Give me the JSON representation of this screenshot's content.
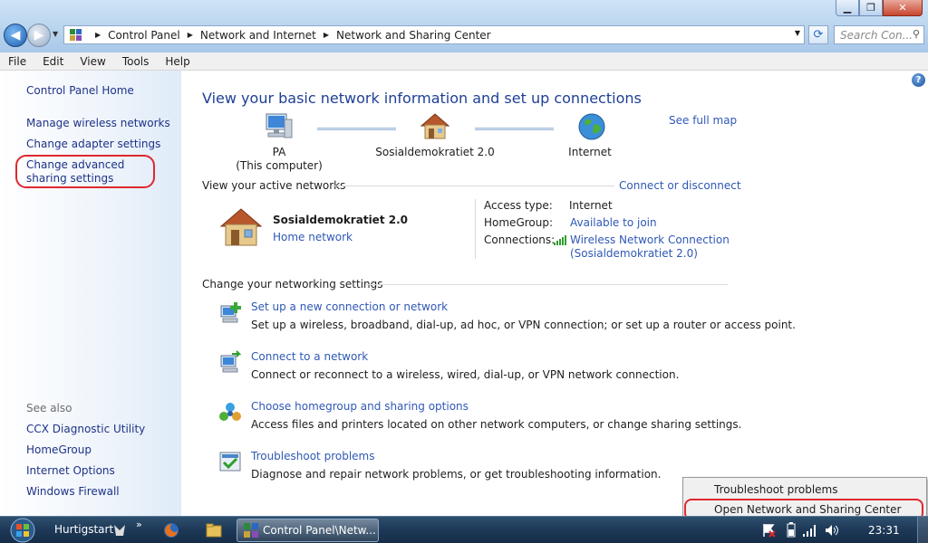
{
  "window": {
    "controls": {
      "minimize": "▁",
      "maximize": "❐",
      "close": "✕"
    }
  },
  "address_bar": {
    "breadcrumbs": [
      "Control Panel",
      "Network and Internet",
      "Network and Sharing Center"
    ],
    "search_placeholder": "Search Con..."
  },
  "menu": [
    "File",
    "Edit",
    "View",
    "Tools",
    "Help"
  ],
  "left_panel": {
    "home": "Control Panel Home",
    "links": [
      "Manage wireless networks",
      "Change adapter settings",
      "Change advanced sharing settings"
    ],
    "see_also_label": "See also",
    "see_also": [
      "CCX Diagnostic Utility",
      "HomeGroup",
      "Internet Options",
      "Windows Firewall"
    ]
  },
  "main": {
    "title": "View your basic network information and set up connections",
    "see_full_map": "See full map",
    "map": {
      "computer_name": "PA",
      "computer_sub": "(This computer)",
      "network": "Sosialdemokratiet 2.0",
      "internet": "Internet"
    },
    "active_networks": {
      "heading": "View your active networks",
      "connect_link": "Connect or disconnect",
      "network_name": "Sosialdemokratiet 2.0",
      "network_type": "Home network",
      "access_type_label": "Access type:",
      "access_type_value": "Internet",
      "homegroup_label": "HomeGroup:",
      "homegroup_value": "Available to join",
      "connections_label": "Connections:",
      "connection_line1": "Wireless Network Connection",
      "connection_line2": "(Sosialdemokratiet 2.0)"
    },
    "settings": {
      "heading": "Change your networking settings",
      "tasks": [
        {
          "link": "Set up a new connection or network",
          "desc": "Set up a wireless, broadband, dial-up, ad hoc, or VPN connection; or set up a router or access point."
        },
        {
          "link": "Connect to a network",
          "desc": "Connect or reconnect to a wireless, wired, dial-up, or VPN network connection."
        },
        {
          "link": "Choose homegroup and sharing options",
          "desc": "Access files and printers located on other network computers, or change sharing settings."
        },
        {
          "link": "Troubleshoot problems",
          "desc": "Diagnose and repair network problems, or get troubleshooting information."
        }
      ]
    }
  },
  "context_menu": {
    "items": [
      "Troubleshoot problems",
      "Open Network and Sharing Center"
    ]
  },
  "taskbar": {
    "quicklaunch_label": "Hurtigstart",
    "chevron": "»",
    "active_app": "Control Panel\\Netw...",
    "clock": "23:31"
  },
  "colors": {
    "link": "#2f58b6",
    "title": "#1e3f96",
    "highlight_oval": "#e0282e"
  }
}
